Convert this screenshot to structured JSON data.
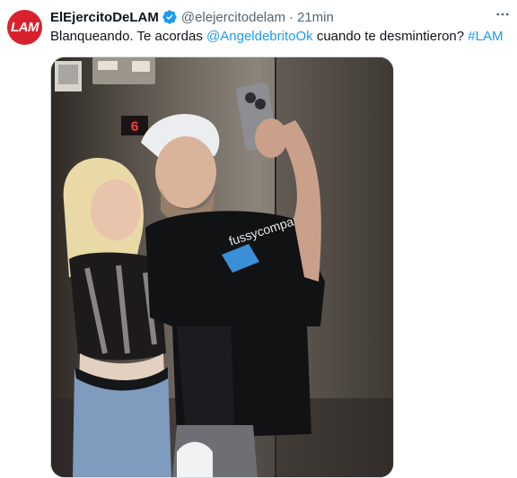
{
  "account": {
    "display_name": "ElEjercitoDeLAM",
    "handle": "@elejercitodelam",
    "separator": "·",
    "time": "21min",
    "avatar_text": "LAM",
    "verified": true
  },
  "tweet": {
    "text_before": "Blanqueando. Te acordas ",
    "mention": "@AngeldebritoOk",
    "text_middle": " cuando te desmintieron? ",
    "hashtag": "#LAM"
  },
  "media": {
    "elevator_floor_display": "6",
    "shirt_print": "fussycompany"
  },
  "colors": {
    "link": "#1d9bf0",
    "verified_badge": "#1d9bf0",
    "avatar_bg": "#d8212d",
    "secondary_text": "#536471"
  },
  "icons": {
    "verified": "verified-badge-icon",
    "more": "more-options-icon"
  }
}
